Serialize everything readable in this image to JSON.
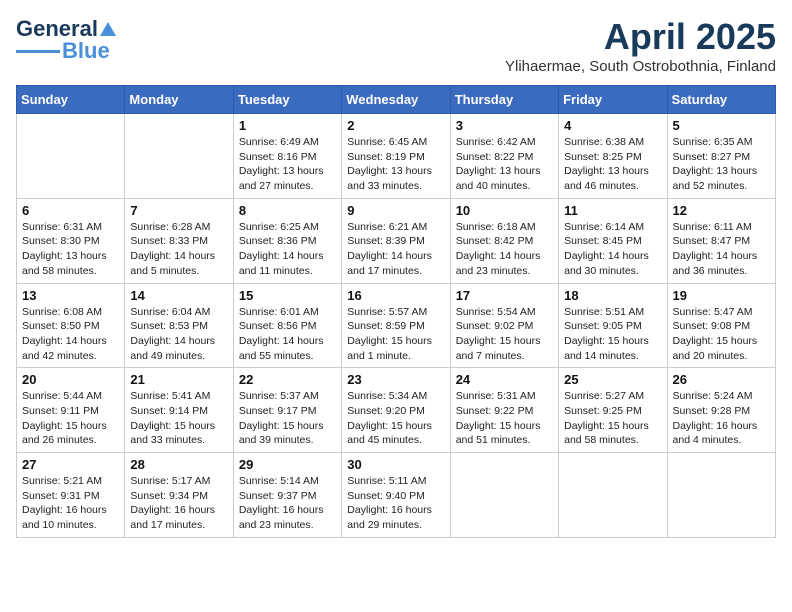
{
  "header": {
    "logo_general": "General",
    "logo_blue": "Blue",
    "month_year": "April 2025",
    "subtitle": "Ylihaermae, South Ostrobothnia, Finland"
  },
  "days_of_week": [
    "Sunday",
    "Monday",
    "Tuesday",
    "Wednesday",
    "Thursday",
    "Friday",
    "Saturday"
  ],
  "weeks": [
    [
      {
        "day": "",
        "text": ""
      },
      {
        "day": "",
        "text": ""
      },
      {
        "day": "1",
        "text": "Sunrise: 6:49 AM\nSunset: 8:16 PM\nDaylight: 13 hours and 27 minutes."
      },
      {
        "day": "2",
        "text": "Sunrise: 6:45 AM\nSunset: 8:19 PM\nDaylight: 13 hours and 33 minutes."
      },
      {
        "day": "3",
        "text": "Sunrise: 6:42 AM\nSunset: 8:22 PM\nDaylight: 13 hours and 40 minutes."
      },
      {
        "day": "4",
        "text": "Sunrise: 6:38 AM\nSunset: 8:25 PM\nDaylight: 13 hours and 46 minutes."
      },
      {
        "day": "5",
        "text": "Sunrise: 6:35 AM\nSunset: 8:27 PM\nDaylight: 13 hours and 52 minutes."
      }
    ],
    [
      {
        "day": "6",
        "text": "Sunrise: 6:31 AM\nSunset: 8:30 PM\nDaylight: 13 hours and 58 minutes."
      },
      {
        "day": "7",
        "text": "Sunrise: 6:28 AM\nSunset: 8:33 PM\nDaylight: 14 hours and 5 minutes."
      },
      {
        "day": "8",
        "text": "Sunrise: 6:25 AM\nSunset: 8:36 PM\nDaylight: 14 hours and 11 minutes."
      },
      {
        "day": "9",
        "text": "Sunrise: 6:21 AM\nSunset: 8:39 PM\nDaylight: 14 hours and 17 minutes."
      },
      {
        "day": "10",
        "text": "Sunrise: 6:18 AM\nSunset: 8:42 PM\nDaylight: 14 hours and 23 minutes."
      },
      {
        "day": "11",
        "text": "Sunrise: 6:14 AM\nSunset: 8:45 PM\nDaylight: 14 hours and 30 minutes."
      },
      {
        "day": "12",
        "text": "Sunrise: 6:11 AM\nSunset: 8:47 PM\nDaylight: 14 hours and 36 minutes."
      }
    ],
    [
      {
        "day": "13",
        "text": "Sunrise: 6:08 AM\nSunset: 8:50 PM\nDaylight: 14 hours and 42 minutes."
      },
      {
        "day": "14",
        "text": "Sunrise: 6:04 AM\nSunset: 8:53 PM\nDaylight: 14 hours and 49 minutes."
      },
      {
        "day": "15",
        "text": "Sunrise: 6:01 AM\nSunset: 8:56 PM\nDaylight: 14 hours and 55 minutes."
      },
      {
        "day": "16",
        "text": "Sunrise: 5:57 AM\nSunset: 8:59 PM\nDaylight: 15 hours and 1 minute."
      },
      {
        "day": "17",
        "text": "Sunrise: 5:54 AM\nSunset: 9:02 PM\nDaylight: 15 hours and 7 minutes."
      },
      {
        "day": "18",
        "text": "Sunrise: 5:51 AM\nSunset: 9:05 PM\nDaylight: 15 hours and 14 minutes."
      },
      {
        "day": "19",
        "text": "Sunrise: 5:47 AM\nSunset: 9:08 PM\nDaylight: 15 hours and 20 minutes."
      }
    ],
    [
      {
        "day": "20",
        "text": "Sunrise: 5:44 AM\nSunset: 9:11 PM\nDaylight: 15 hours and 26 minutes."
      },
      {
        "day": "21",
        "text": "Sunrise: 5:41 AM\nSunset: 9:14 PM\nDaylight: 15 hours and 33 minutes."
      },
      {
        "day": "22",
        "text": "Sunrise: 5:37 AM\nSunset: 9:17 PM\nDaylight: 15 hours and 39 minutes."
      },
      {
        "day": "23",
        "text": "Sunrise: 5:34 AM\nSunset: 9:20 PM\nDaylight: 15 hours and 45 minutes."
      },
      {
        "day": "24",
        "text": "Sunrise: 5:31 AM\nSunset: 9:22 PM\nDaylight: 15 hours and 51 minutes."
      },
      {
        "day": "25",
        "text": "Sunrise: 5:27 AM\nSunset: 9:25 PM\nDaylight: 15 hours and 58 minutes."
      },
      {
        "day": "26",
        "text": "Sunrise: 5:24 AM\nSunset: 9:28 PM\nDaylight: 16 hours and 4 minutes."
      }
    ],
    [
      {
        "day": "27",
        "text": "Sunrise: 5:21 AM\nSunset: 9:31 PM\nDaylight: 16 hours and 10 minutes."
      },
      {
        "day": "28",
        "text": "Sunrise: 5:17 AM\nSunset: 9:34 PM\nDaylight: 16 hours and 17 minutes."
      },
      {
        "day": "29",
        "text": "Sunrise: 5:14 AM\nSunset: 9:37 PM\nDaylight: 16 hours and 23 minutes."
      },
      {
        "day": "30",
        "text": "Sunrise: 5:11 AM\nSunset: 9:40 PM\nDaylight: 16 hours and 29 minutes."
      },
      {
        "day": "",
        "text": ""
      },
      {
        "day": "",
        "text": ""
      },
      {
        "day": "",
        "text": ""
      }
    ]
  ]
}
